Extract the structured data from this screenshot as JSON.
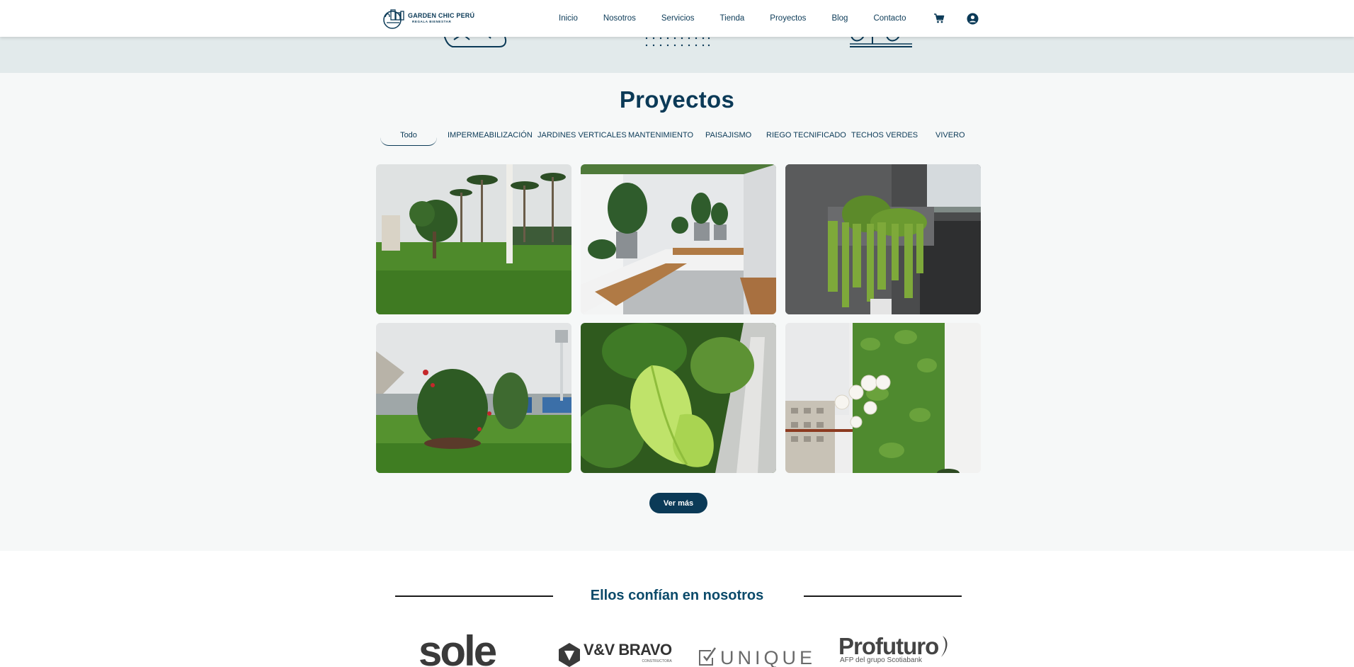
{
  "header": {
    "logo": {
      "name": "GARDEN CHIC PERÚ",
      "tagline": "REGALA BIENESTAR"
    },
    "nav": [
      "Inicio",
      "Nosotros",
      "Servicios",
      "Tienda",
      "Proyectos",
      "Blog",
      "Contacto"
    ],
    "icons": [
      "cart-icon",
      "user-account-icon"
    ]
  },
  "projects": {
    "title": "Proyectos",
    "filters": [
      "Todo",
      "IMPERMEABILIZACIÓN",
      "JARDINES VERTICALES",
      "MANTENIMIENTO",
      "PAISAJISMO",
      "RIEGO TECNIFICADO",
      "TECHOS VERDES",
      "VIVERO"
    ],
    "active_filter": "Todo",
    "photos": [
      "park-lawn-palm-trees-photo",
      "white-terrace-potted-plants-photo",
      "balcony-hanging-plants-photo",
      "hibiscus-shrub-lawn-photo",
      "green-leaf-closeup-photo",
      "vertical-garden-orchids-photo"
    ],
    "button": "Ver más"
  },
  "clients": {
    "title": "Ellos confían en nosotros",
    "logos": {
      "sole": "sole",
      "vv_bravo": "V&V BRAVO",
      "vv_bravo_sub": "CONSTRUCTORA",
      "unique": "UNIQUE",
      "profuturo": "Profuturo",
      "profuturo_sub": "AFP del grupo Scotiabank"
    }
  },
  "colors": {
    "primary": "#0b3a57",
    "band": "#e2eaeb",
    "section_bg": "#f6f8f8"
  }
}
